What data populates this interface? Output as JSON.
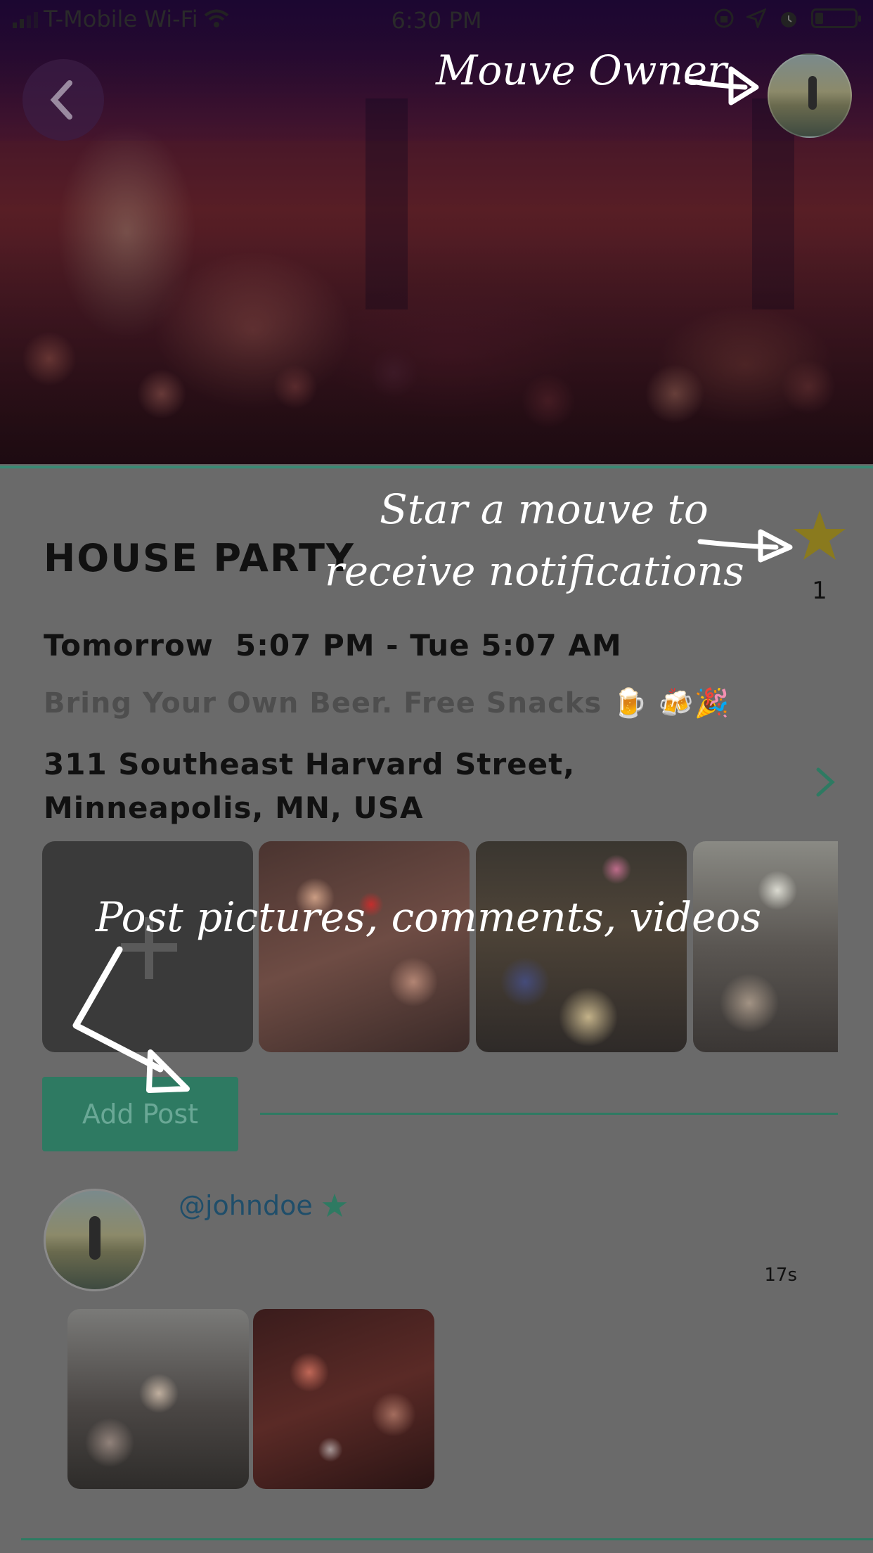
{
  "status_bar": {
    "carrier": "T-Mobile Wi-Fi",
    "time": "6:30 PM",
    "icons": [
      "wifi-icon",
      "orientation-lock-icon",
      "location-icon",
      "alarm-icon",
      "battery-icon"
    ]
  },
  "header": {
    "back_icon": "chevron-left-icon"
  },
  "event": {
    "title": "HOUSE PARTY",
    "star_count": "1",
    "when": "Tomorrow  5:07 PM - Tue 5:07 AM",
    "description": "Bring Your Own Beer. Free Snacks 🍺 🍻🎉",
    "address": "311 Southeast Harvard Street, Minneapolis, MN, USA"
  },
  "media": {
    "add_tile_icon": "plus-icon",
    "thumbnails": [
      "party-photo",
      "party-photo",
      "party-photo"
    ]
  },
  "actions": {
    "add_post_label": "Add Post"
  },
  "post": {
    "username": "@johndoe",
    "timestamp": "17s",
    "images": [
      "party-photo",
      "party-photo"
    ]
  },
  "annotations": {
    "owner": "Mouve Owner",
    "star_line1": "Star a mouve to",
    "star_line2": "receive notifications",
    "post": "Post pictures, comments, videos"
  },
  "colors": {
    "accent_green": "#2e7a62",
    "star_gold": "#8a7a1e",
    "username_blue": "#1f4e6a",
    "background_overlay": "#6a6a6a"
  }
}
